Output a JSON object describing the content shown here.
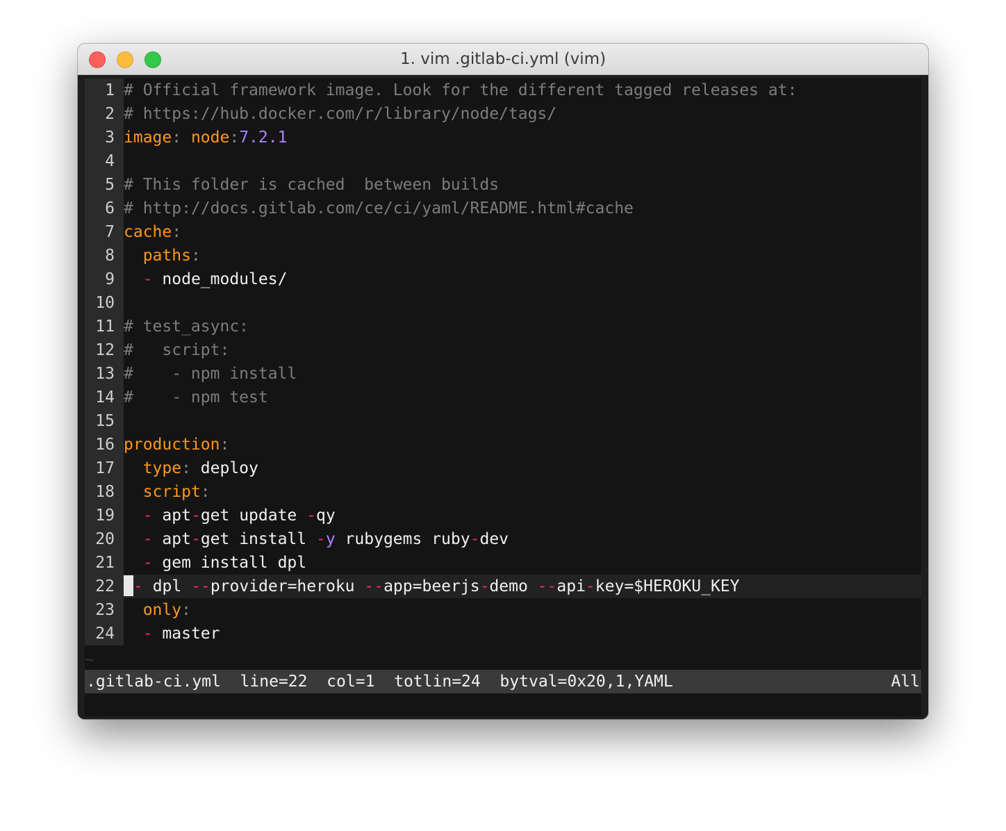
{
  "window": {
    "title": "1. vim .gitlab-ci.yml (vim)"
  },
  "colors": {
    "key": "#fd971f",
    "comment": "#7c7c7c",
    "text": "#f0f0f0",
    "dash": "#f92672",
    "number": "#ae81ff",
    "punct": "#8a8a8a"
  },
  "editor": {
    "current_line": 22,
    "lines": [
      {
        "num": "1",
        "tokens": [
          {
            "t": "# Official framework image. Look for the different tagged releases at:",
            "c": "comment"
          }
        ]
      },
      {
        "num": "2",
        "tokens": [
          {
            "t": "# https://hub.docker.com/r/library/node/tags/",
            "c": "comment"
          }
        ]
      },
      {
        "num": "3",
        "tokens": [
          {
            "t": "image",
            "c": "key"
          },
          {
            "t": ": ",
            "c": "punct"
          },
          {
            "t": "node",
            "c": "key"
          },
          {
            "t": ":",
            "c": "punct"
          },
          {
            "t": "7.2.",
            "c": "number"
          },
          {
            "t": "1",
            "c": "number"
          }
        ]
      },
      {
        "num": "4",
        "tokens": []
      },
      {
        "num": "5",
        "tokens": [
          {
            "t": "# This folder is cached  between builds",
            "c": "comment"
          }
        ]
      },
      {
        "num": "6",
        "tokens": [
          {
            "t": "# http://docs.gitlab.com/ce/ci/yaml/README.html#cache",
            "c": "comment"
          }
        ]
      },
      {
        "num": "7",
        "tokens": [
          {
            "t": "cache",
            "c": "key"
          },
          {
            "t": ":",
            "c": "punct"
          }
        ]
      },
      {
        "num": "8",
        "tokens": [
          {
            "t": "  ",
            "c": "text"
          },
          {
            "t": "paths",
            "c": "key"
          },
          {
            "t": ":",
            "c": "punct"
          }
        ]
      },
      {
        "num": "9",
        "tokens": [
          {
            "t": "  ",
            "c": "text"
          },
          {
            "t": "-",
            "c": "dash"
          },
          {
            "t": " node_modules/",
            "c": "text"
          }
        ]
      },
      {
        "num": "10",
        "tokens": []
      },
      {
        "num": "11",
        "tokens": [
          {
            "t": "# test_async:",
            "c": "comment"
          }
        ]
      },
      {
        "num": "12",
        "tokens": [
          {
            "t": "#   script:",
            "c": "comment"
          }
        ]
      },
      {
        "num": "13",
        "tokens": [
          {
            "t": "#    - npm install",
            "c": "comment"
          }
        ]
      },
      {
        "num": "14",
        "tokens": [
          {
            "t": "#    - npm test",
            "c": "comment"
          }
        ]
      },
      {
        "num": "15",
        "tokens": []
      },
      {
        "num": "16",
        "tokens": [
          {
            "t": "production",
            "c": "key"
          },
          {
            "t": ":",
            "c": "punct"
          }
        ]
      },
      {
        "num": "17",
        "tokens": [
          {
            "t": "  ",
            "c": "text"
          },
          {
            "t": "type",
            "c": "key"
          },
          {
            "t": ": ",
            "c": "punct"
          },
          {
            "t": "deploy",
            "c": "text"
          }
        ]
      },
      {
        "num": "18",
        "tokens": [
          {
            "t": "  ",
            "c": "text"
          },
          {
            "t": "script",
            "c": "key"
          },
          {
            "t": ":",
            "c": "punct"
          }
        ]
      },
      {
        "num": "19",
        "tokens": [
          {
            "t": "  ",
            "c": "text"
          },
          {
            "t": "-",
            "c": "dash"
          },
          {
            "t": " apt",
            "c": "text"
          },
          {
            "t": "-",
            "c": "dash"
          },
          {
            "t": "get update ",
            "c": "text"
          },
          {
            "t": "-",
            "c": "dash"
          },
          {
            "t": "qy",
            "c": "text"
          }
        ]
      },
      {
        "num": "20",
        "tokens": [
          {
            "t": "  ",
            "c": "text"
          },
          {
            "t": "-",
            "c": "dash"
          },
          {
            "t": " apt",
            "c": "text"
          },
          {
            "t": "-",
            "c": "dash"
          },
          {
            "t": "get install ",
            "c": "text"
          },
          {
            "t": "-",
            "c": "dash"
          },
          {
            "t": "y",
            "c": "number"
          },
          {
            "t": " rubygems ruby",
            "c": "text"
          },
          {
            "t": "-",
            "c": "dash"
          },
          {
            "t": "dev",
            "c": "text"
          }
        ]
      },
      {
        "num": "21",
        "tokens": [
          {
            "t": "  ",
            "c": "text"
          },
          {
            "t": "-",
            "c": "dash"
          },
          {
            "t": " gem install dpl",
            "c": "text"
          }
        ]
      },
      {
        "num": "22",
        "tokens": [
          {
            "t": " ",
            "c": "text"
          },
          {
            "t": "-",
            "c": "dash"
          },
          {
            "t": " dpl ",
            "c": "text"
          },
          {
            "t": "--",
            "c": "dash"
          },
          {
            "t": "provider=heroku ",
            "c": "text"
          },
          {
            "t": "--",
            "c": "dash"
          },
          {
            "t": "app=beerjs",
            "c": "text"
          },
          {
            "t": "-",
            "c": "dash"
          },
          {
            "t": "demo ",
            "c": "text"
          },
          {
            "t": "--",
            "c": "dash"
          },
          {
            "t": "api",
            "c": "text"
          },
          {
            "t": "-",
            "c": "dash"
          },
          {
            "t": "key=$HEROKU_KEY",
            "c": "text"
          }
        ]
      },
      {
        "num": "23",
        "tokens": [
          {
            "t": "  ",
            "c": "text"
          },
          {
            "t": "only",
            "c": "key"
          },
          {
            "t": ":",
            "c": "punct"
          }
        ]
      },
      {
        "num": "24",
        "tokens": [
          {
            "t": "  ",
            "c": "text"
          },
          {
            "t": "-",
            "c": "dash"
          },
          {
            "t": " master",
            "c": "text"
          }
        ]
      }
    ],
    "tilde": "~"
  },
  "statusline": {
    "left": ".gitlab-ci.yml  line=22  col=1  totlin=24  bytval=0x20,1,YAML",
    "right": "All"
  }
}
